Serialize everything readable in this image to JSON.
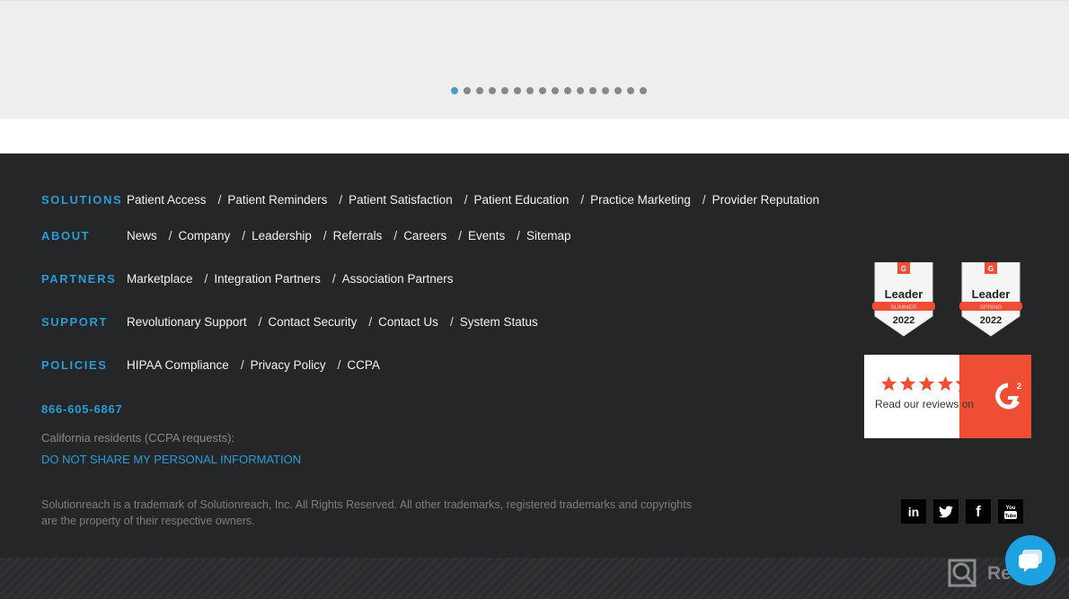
{
  "carousel": {
    "dot_count": 16,
    "active_index": 0
  },
  "footer": {
    "nav": [
      {
        "heading": "SOLUTIONS",
        "links": [
          "Patient Access",
          "Patient Reminders",
          "Patient Satisfaction",
          "Patient Education",
          "Practice Marketing",
          "Provider Reputation"
        ]
      },
      {
        "heading": "ABOUT",
        "links": [
          "News",
          "Company",
          "Leadership",
          "Referrals",
          "Careers",
          "Events",
          "Sitemap"
        ]
      },
      {
        "heading": "PARTNERS",
        "links": [
          "Marketplace",
          "Integration Partners",
          "Association Partners"
        ]
      },
      {
        "heading": "SUPPORT",
        "links": [
          "Revolutionary Support",
          "Contact Security",
          "Contact Us",
          "System Status"
        ]
      },
      {
        "heading": "POLICIES",
        "links": [
          "HIPAA Compliance",
          "Privacy Policy",
          "CCPA"
        ]
      }
    ],
    "separator": "/",
    "phone": "866-605-6867",
    "ccpa_label": "California residents (CCPA requests):",
    "ccpa_link": "DO NOT SHARE MY PERSONAL INFORMATION",
    "legal": "Solutionreach is a trademark of Solutionreach, Inc. All Rights Reserved. All other trademarks, registered trademarks and copyrights are the property of their respective owners."
  },
  "badges": [
    {
      "title": "Leader",
      "season": "SUMMER",
      "year": "2022"
    },
    {
      "title": "Leader",
      "season": "SPRING",
      "year": "2022"
    }
  ],
  "g2_review": {
    "rating": 4.5,
    "text": "Read our reviews on",
    "logo": "G2"
  },
  "social": [
    {
      "name": "linkedin",
      "glyph": "in"
    },
    {
      "name": "twitter",
      "glyph": "🐦"
    },
    {
      "name": "facebook",
      "glyph": "f"
    },
    {
      "name": "youtube",
      "glyph": "You"
    }
  ],
  "watermark": "Revain",
  "colors": {
    "accent": "#2a9bd6",
    "g2_orange": "#ef4e35",
    "footer_bg": "#252628"
  }
}
